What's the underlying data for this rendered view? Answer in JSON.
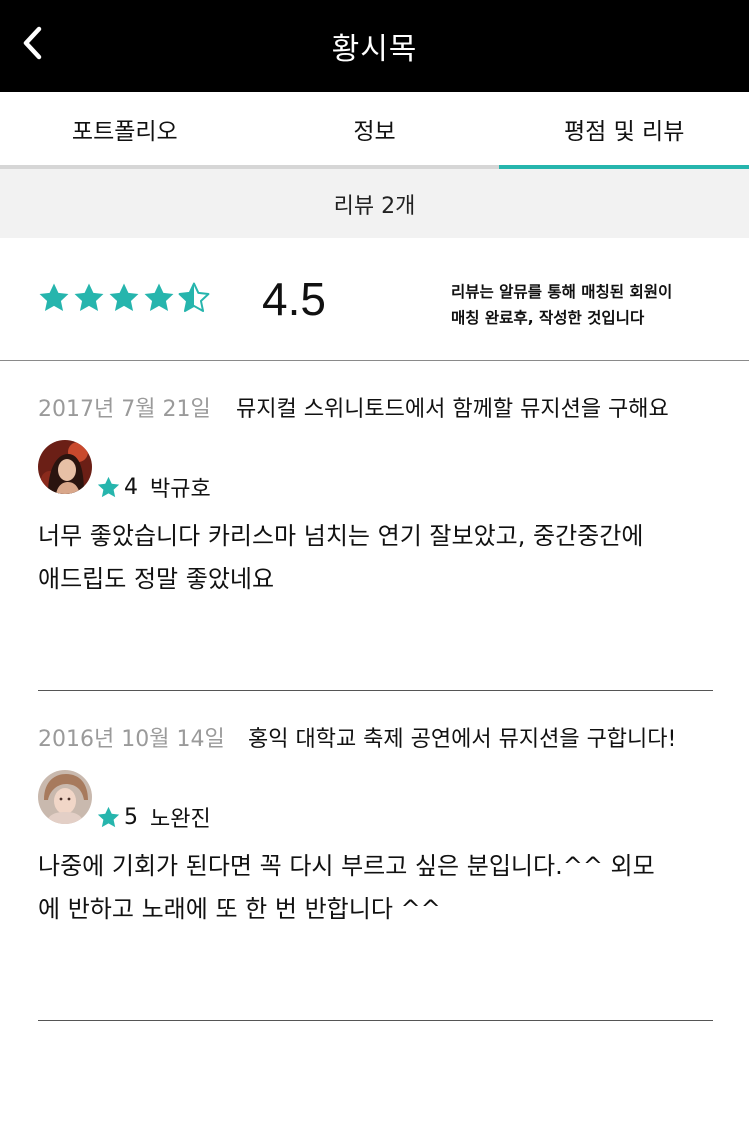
{
  "header": {
    "title": "황시목",
    "back_icon": "chevron-left-icon"
  },
  "tabs": [
    {
      "label": "포트폴리오",
      "active": false
    },
    {
      "label": "정보",
      "active": false
    },
    {
      "label": "평점 및 리뷰",
      "active": true
    }
  ],
  "review_count_label": "리뷰 2개",
  "summary": {
    "rating_value": "4.5",
    "stars_filled": 4.5,
    "stars_total": 5,
    "notice_line1": "리뷰는 알뮤를 통해 매칭된 회원이",
    "notice_line2": "매칭 완료후, 작성한 것입니다"
  },
  "reviews": [
    {
      "date": "2017년 7월 21일",
      "gig_title": "뮤지컬 스위니토드에서 함께할 뮤지션을 구해요",
      "rating": "4",
      "reviewer": "박규호",
      "text_line1": "너무 좋았습니다 카리스마 넘치는 연기 잘보았고, 중간중간에",
      "text_line2": "애드립도 정말 좋았네요"
    },
    {
      "date": "2016년 10월 14일",
      "gig_title": "홍익 대학교 축제 공연에서 뮤지션을 구합니다!",
      "rating": "5",
      "reviewer": "노완진",
      "text_line1": "나중에 기회가 된다면 꼭 다시 부르고 싶은 분입니다.^^ 외모",
      "text_line2": "에 반하고 노래에 또 한 번 반합니다 ^^"
    }
  ],
  "colors": {
    "accent": "#26b5ad",
    "header_bg": "#000000",
    "count_bar_bg": "#f2f2f2",
    "date_text": "#9a9a9a"
  }
}
